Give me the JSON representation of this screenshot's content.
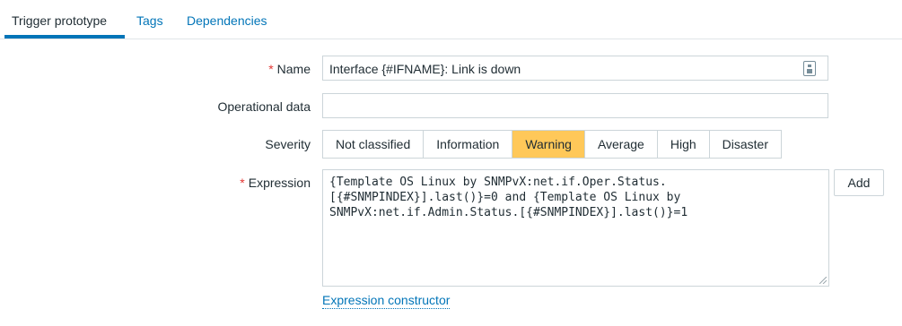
{
  "tabs": [
    {
      "label": "Trigger prototype",
      "active": true
    },
    {
      "label": "Tags",
      "active": false
    },
    {
      "label": "Dependencies",
      "active": false
    }
  ],
  "form": {
    "name": {
      "label": "Name",
      "required": true,
      "value": "Interface {#IFNAME}: Link is down"
    },
    "operational_data": {
      "label": "Operational data",
      "value": ""
    },
    "severity": {
      "label": "Severity",
      "options": [
        "Not classified",
        "Information",
        "Warning",
        "Average",
        "High",
        "Disaster"
      ],
      "selected": "Warning",
      "selected_color": "#ffc859"
    },
    "expression": {
      "label": "Expression",
      "required": true,
      "value": "{Template OS Linux by SNMPvX:net.if.Oper.Status.\n[{#SNMPINDEX}].last()}=0 and {Template OS Linux by\nSNMPvX:net.if.Admin.Status.[{#SNMPINDEX}].last()}=1",
      "add_label": "Add",
      "constructor_label": "Expression constructor"
    }
  },
  "colors": {
    "link": "#0275b8",
    "required": "#e33734",
    "accent": "#0275b8"
  },
  "icons": {
    "name_macro": "macro-icon",
    "resize": "resize-handle-icon"
  }
}
